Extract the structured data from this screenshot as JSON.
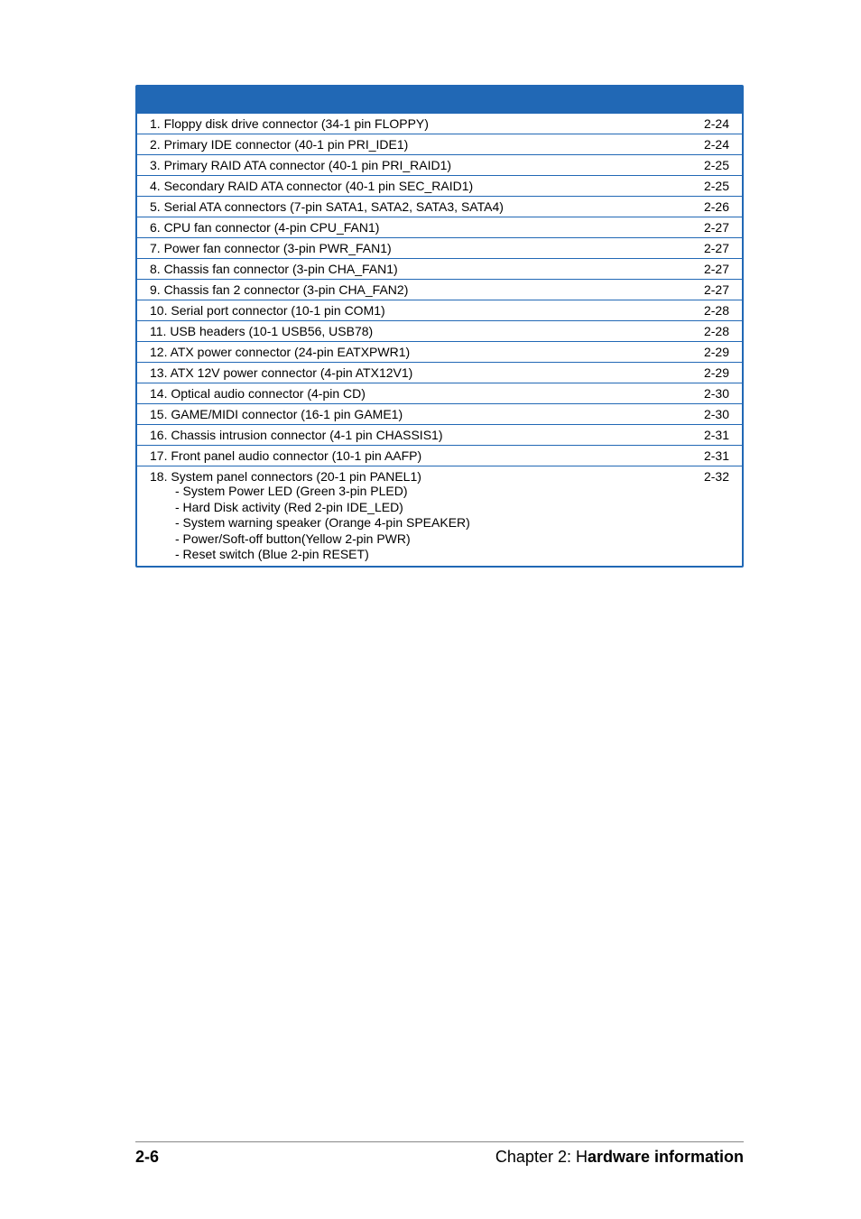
{
  "rows": [
    {
      "label": "1. Floppy disk drive connector (34-1 pin FLOPPY)",
      "page": "2-24"
    },
    {
      "label": "2. Primary IDE connector (40-1 pin PRI_IDE1)",
      "page": "2-24"
    },
    {
      "label": "3. Primary RAID ATA connector (40-1 pin PRI_RAID1)",
      "page": "2-25"
    },
    {
      "label": "4. Secondary RAID ATA connector (40-1 pin SEC_RAID1)",
      "page": "2-25"
    },
    {
      "label": "5. Serial ATA connectors (7-pin SATA1, SATA2, SATA3, SATA4)",
      "page": "2-26"
    },
    {
      "label": "6. CPU fan connector (4-pin CPU_FAN1)",
      "page": "2-27"
    },
    {
      "label": "7. Power fan connector (3-pin PWR_FAN1)",
      "page": "2-27"
    },
    {
      "label": "8. Chassis fan connector (3-pin CHA_FAN1)",
      "page": "2-27"
    },
    {
      "label": "9. Chassis fan 2 connector (3-pin CHA_FAN2)",
      "page": "2-27"
    },
    {
      "label": "10. Serial port connector (10-1 pin COM1)",
      "page": "2-28"
    },
    {
      "label": "11. USB headers (10-1 USB56, USB78)",
      "page": "2-28"
    },
    {
      "label": "12. ATX power connector (24-pin EATXPWR1)",
      "page": "2-29"
    },
    {
      "label": "13. ATX 12V power connector (4-pin ATX12V1)",
      "page": "2-29"
    },
    {
      "label": "14. Optical audio connector (4-pin CD)",
      "page": "2-30"
    },
    {
      "label": "15. GAME/MIDI connector (16-1 pin GAME1)",
      "page": "2-30"
    },
    {
      "label": "16. Chassis intrusion connector (4-1 pin CHASSIS1)",
      "page": "2-31"
    },
    {
      "label": "17. Front panel audio connector (10-1 pin AAFP)",
      "page": "2-31"
    }
  ],
  "lastRow": {
    "label": "18. System panel connectors (20-1 pin PANEL1)",
    "page": "2-32",
    "subitems": [
      "- System Power LED (Green 3-pin PLED)",
      "- Hard Disk activity (Red 2-pin IDE_LED)",
      "- System warning speaker (Orange 4-pin SPEAKER)",
      "- Power/Soft-off button(Yellow 2-pin PWR)",
      "- Reset switch (Blue 2-pin RESET)"
    ]
  },
  "footer": {
    "pageNumber": "2-6",
    "chapterPrefix": "Chapter 2: H",
    "chapterBold": "ardware information"
  }
}
